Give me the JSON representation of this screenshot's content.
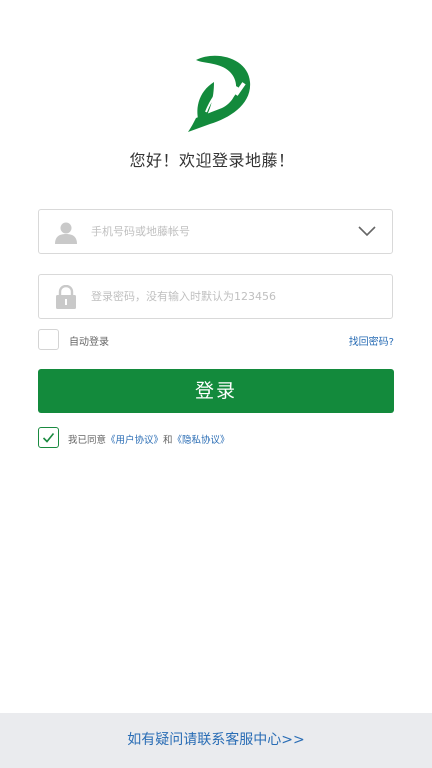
{
  "app": {
    "greeting": "您好！欢迎登录地藤！"
  },
  "colors": {
    "brand_green": "#138a3c",
    "link_blue": "#2a6db5",
    "footer_bg": "#eaebee"
  },
  "form": {
    "account": {
      "icon": "user-icon",
      "value": "",
      "placeholder": "手机号码或地藤帐号",
      "dropdown_icon": "chevron-down-icon"
    },
    "password": {
      "icon": "lock-icon",
      "value": "",
      "placeholder": "登录密码，没有输入时默认为123456"
    },
    "auto_login": {
      "label": "自动登录",
      "checked": false
    },
    "forgot_password_label": "找回密码?",
    "login_button_label": "登录"
  },
  "agreement": {
    "checked": true,
    "prefix": "我已同意",
    "user_agreement": "《用户协议》",
    "conjunction": "和",
    "privacy_policy": "《隐私协议》"
  },
  "footer": {
    "help_label": "如有疑问请联系客服中心>>"
  }
}
